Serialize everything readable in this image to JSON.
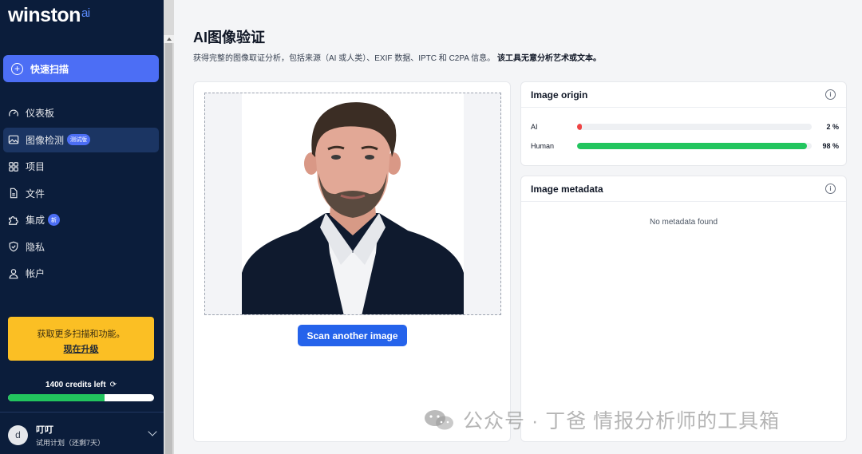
{
  "sidebar": {
    "logo": "winston",
    "logo_suffix": "ai",
    "quick_scan": "快速扫描",
    "items": [
      {
        "label": "仪表板",
        "icon": "gauge-icon"
      },
      {
        "label": "图像检测",
        "icon": "image-icon",
        "badge": "测试版"
      },
      {
        "label": "项目",
        "icon": "grid-icon"
      },
      {
        "label": "文件",
        "icon": "document-icon"
      },
      {
        "label": "集成",
        "icon": "puzzle-icon",
        "badge": "新"
      },
      {
        "label": "隐私",
        "icon": "shield-icon"
      },
      {
        "label": "帐户",
        "icon": "user-icon"
      }
    ],
    "upgrade_text": "获取更多扫描和功能。",
    "upgrade_link": "现在升级",
    "credits_text": "1400 credits left",
    "credits_fraction": 0.66,
    "user_initial": "d",
    "user_name": "叮叮",
    "user_plan": "试用计划（还剩7天）"
  },
  "main": {
    "title": "AI图像验证",
    "subtitle": "获得完整的图像取证分析，包括来源（AI 或人类）、EXIF 数据、IPTC 和 C2PA 信息。",
    "subtitle_bold": "该工具无意分析艺术或文本。",
    "scan_button": "Scan another image",
    "origin": {
      "title": "Image origin",
      "rows": [
        {
          "label": "AI",
          "value": 2,
          "display": "2 %",
          "color": "#ef4444"
        },
        {
          "label": "Human",
          "value": 98,
          "display": "98 %",
          "color": "#22c55e"
        }
      ]
    },
    "metadata": {
      "title": "Image metadata",
      "empty_text": "No metadata found"
    }
  },
  "watermark": "公众号 · 丁爸 情报分析师的工具箱",
  "colors": {
    "sidebar_bg": "#0b1d3b",
    "accent": "#4c6ef5",
    "button": "#2563eb",
    "upgrade": "#fbbf24",
    "success": "#22c55e",
    "danger": "#ef4444"
  }
}
